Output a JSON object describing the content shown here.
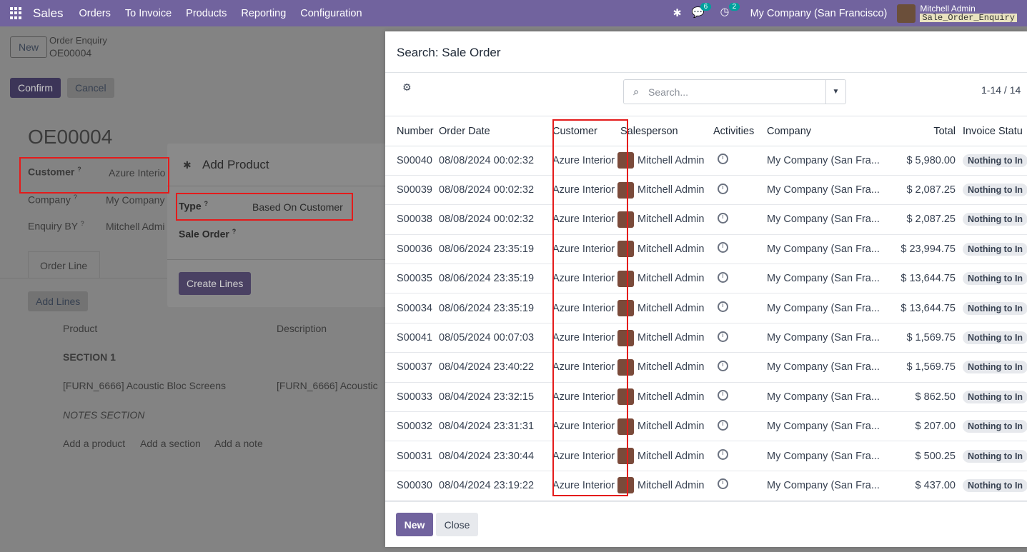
{
  "navbar": {
    "brand": "Sales",
    "menu": [
      "Orders",
      "To Invoice",
      "Products",
      "Reporting",
      "Configuration"
    ],
    "messages_count": "6",
    "activities_count": "2",
    "company": "My Company (San Francisco)",
    "user_name": "Mitchell Admin",
    "db_name": "Sale_Order_Enquiry"
  },
  "background": {
    "new_label": "New",
    "breadcrumb_title": "Order Enquiry",
    "breadcrumb_record": "OE00004",
    "confirm_label": "Confirm",
    "cancel_label": "Cancel",
    "record_name": "OE00004",
    "customer_label": "Customer",
    "customer_help": "?",
    "customer_value": "Azure Interio",
    "company_label": "Company",
    "company_help": "?",
    "company_value": "My Company",
    "enquiry_label": "Enquiry BY",
    "enquiry_help": "?",
    "enquiry_value": "Mitchell Admi",
    "tab_order_line": "Order Line",
    "add_lines_label": "Add Lines",
    "col_product": "Product",
    "col_description": "Description",
    "section_1": "SECTION 1",
    "line_product": "[FURN_6666] Acoustic Bloc Screens",
    "line_description": "[FURN_6666] Acoustic",
    "notes_section": "NOTES SECTION",
    "add_product": "Add a product",
    "add_section": "Add a section",
    "add_note": "Add a note"
  },
  "add_product_dialog": {
    "title": "Add Product",
    "type_label": "Type",
    "type_help": "?",
    "type_value": "Based On Customer",
    "sale_order_label": "Sale Order",
    "sale_order_help": "?",
    "create_lines_label": "Create Lines"
  },
  "modal": {
    "title": "Search: Sale Order",
    "search_placeholder": "Search...",
    "pager": "1-14 / 14",
    "columns": [
      "Number",
      "Order Date",
      "Customer",
      "Salesperson",
      "Activities",
      "Company",
      "Total",
      "Invoice Statu"
    ],
    "rows": [
      [
        "S00040",
        "08/08/2024 00:02:32",
        "Azure Interior",
        "Mitchell Admin",
        "My Company (San Fra...",
        "$ 5,980.00",
        "Nothing to In"
      ],
      [
        "S00039",
        "08/08/2024 00:02:32",
        "Azure Interior",
        "Mitchell Admin",
        "My Company (San Fra...",
        "$ 2,087.25",
        "Nothing to In"
      ],
      [
        "S00038",
        "08/08/2024 00:02:32",
        "Azure Interior",
        "Mitchell Admin",
        "My Company (San Fra...",
        "$ 2,087.25",
        "Nothing to In"
      ],
      [
        "S00036",
        "08/06/2024 23:35:19",
        "Azure Interior",
        "Mitchell Admin",
        "My Company (San Fra...",
        "$ 23,994.75",
        "Nothing to In"
      ],
      [
        "S00035",
        "08/06/2024 23:35:19",
        "Azure Interior",
        "Mitchell Admin",
        "My Company (San Fra...",
        "$ 13,644.75",
        "Nothing to In"
      ],
      [
        "S00034",
        "08/06/2024 23:35:19",
        "Azure Interior",
        "Mitchell Admin",
        "My Company (San Fra...",
        "$ 13,644.75",
        "Nothing to In"
      ],
      [
        "S00041",
        "08/05/2024 00:07:03",
        "Azure Interior",
        "Mitchell Admin",
        "My Company (San Fra...",
        "$ 1,569.75",
        "Nothing to In"
      ],
      [
        "S00037",
        "08/04/2024 23:40:22",
        "Azure Interior",
        "Mitchell Admin",
        "My Company (San Fra...",
        "$ 1,569.75",
        "Nothing to In"
      ],
      [
        "S00033",
        "08/04/2024 23:32:15",
        "Azure Interior",
        "Mitchell Admin",
        "My Company (San Fra...",
        "$ 862.50",
        "Nothing to In"
      ],
      [
        "S00032",
        "08/04/2024 23:31:31",
        "Azure Interior",
        "Mitchell Admin",
        "My Company (San Fra...",
        "$ 207.00",
        "Nothing to In"
      ],
      [
        "S00031",
        "08/04/2024 23:30:44",
        "Azure Interior",
        "Mitchell Admin",
        "My Company (San Fra...",
        "$ 500.25",
        "Nothing to In"
      ],
      [
        "S00030",
        "08/04/2024 23:19:22",
        "Azure Interior",
        "Mitchell Admin",
        "My Company (San Fra...",
        "$ 437.00",
        "Nothing to In"
      ]
    ],
    "new_label": "New",
    "close_label": "Close"
  },
  "colors": {
    "navbar": "#71639e",
    "primary": "#71639e",
    "highlight": "#e41b1b",
    "backdrop": "#838383"
  }
}
